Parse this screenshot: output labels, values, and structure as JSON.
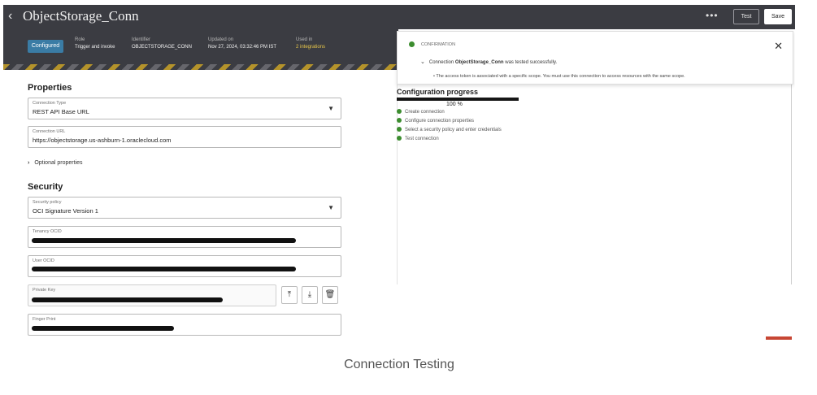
{
  "header": {
    "back_icon": "chevron-left-icon",
    "title": "ObjectStorage_Conn",
    "more_icon": "more-horizontal-icon",
    "test_label": "Test",
    "save_label": "Save"
  },
  "banner": {
    "status": "Configured",
    "role_label": "Role",
    "role_value": "Trigger and invoke",
    "identifier_label": "Identifier",
    "identifier_value": "OBJECTSTORAGE_CONN",
    "updated_label": "Updated on",
    "updated_value": "Nov 27, 2024, 03:32:46 PM IST",
    "used_label": "Used in",
    "used_value": "2 integrations"
  },
  "properties": {
    "title": "Properties",
    "connection_type_label": "Connection Type",
    "connection_type_value": "REST API Base URL",
    "connection_url_label": "Connection URL",
    "connection_url_value": "https://objectstorage.us-ashburn-1.oraclecloud.com",
    "optional_label": "Optional properties"
  },
  "security": {
    "title": "Security",
    "policy_label": "Security policy",
    "policy_value": "OCI Signature Version 1",
    "tenancy_label": "Tenancy OCID",
    "user_label": "User OCID",
    "private_key_label": "Private Key",
    "finger_print_label": "Finger Print",
    "upload_icon": "upload-icon",
    "download_icon": "download-icon",
    "delete_icon": "trash-icon"
  },
  "notification": {
    "type": "CONFIRMATION",
    "message_prefix": "Connection ",
    "message_name": "ObjectStorage_Conn",
    "message_suffix": " was tested successfully.",
    "detail": "The access token is associated with a specific scope. You must use this connection to access resources with the same scope.",
    "close_icon": "close-icon"
  },
  "progress": {
    "title": "Configuration progress",
    "percent_label": "100 %",
    "fraction": 1.0,
    "steps": [
      "Create connection",
      "Configure connection properties",
      "Select a security policy and enter credentials",
      "Test connection"
    ]
  },
  "caption": "Connection Testing",
  "colors": {
    "topbar": "#3b3c42",
    "badge": "#3a7ca5",
    "success": "#3c8d2f",
    "link": "#e7c64a",
    "accent_red": "#c74634"
  }
}
